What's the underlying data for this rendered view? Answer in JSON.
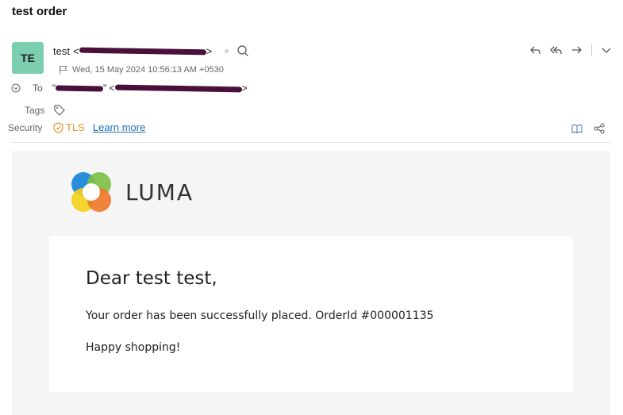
{
  "subject": "test order",
  "sender": {
    "avatar_initials": "TE",
    "name": "test",
    "open_bracket": "<",
    "close_bracket": ">",
    "date": "Wed, 15 May 2024 10:56:13 AM +0530"
  },
  "meta": {
    "to_label": "To",
    "to_open_quote": "\"",
    "to_mid": "\" <",
    "to_close": ">",
    "tags_label": "Tags",
    "security_label": "Security",
    "tls_label": "TLS",
    "learn_more": "Learn more"
  },
  "email_body": {
    "brand": "LUMA",
    "greeting": "Dear test test,",
    "message": "Your order has been successfully placed. OrderId #000001135",
    "closing": "Happy shopping!"
  },
  "colors": {
    "avatar": "#7ccfae",
    "tls": "#e8932f",
    "link": "#1f6fb2",
    "redaction": "#4a0f3a",
    "logo_blue": "#1e88d8",
    "logo_green": "#7bc043",
    "logo_yellow": "#f3d21a",
    "logo_orange": "#f0782b"
  },
  "icons": [
    "flag-icon",
    "search-icon",
    "reply-icon",
    "reply-all-icon",
    "forward-icon",
    "chevron-down-icon",
    "expand-icon",
    "tag-icon",
    "shield-icon",
    "book-icon",
    "share-icon"
  ]
}
